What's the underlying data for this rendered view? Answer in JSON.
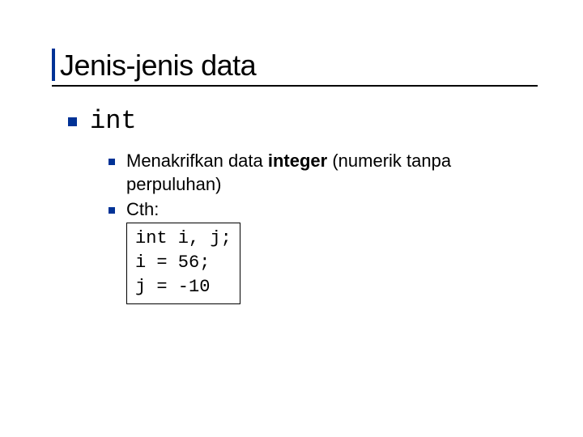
{
  "title": "Jenis-jenis data",
  "l1": {
    "label": "int"
  },
  "sub": {
    "item1": {
      "prefix": "Menakrifkan data ",
      "bold": "integer",
      "suffix": " (numerik tanpa perpuluhan)"
    },
    "item2": {
      "label": "Cth:",
      "code": "int i, j;\ni = 56;\nj = -10"
    }
  }
}
